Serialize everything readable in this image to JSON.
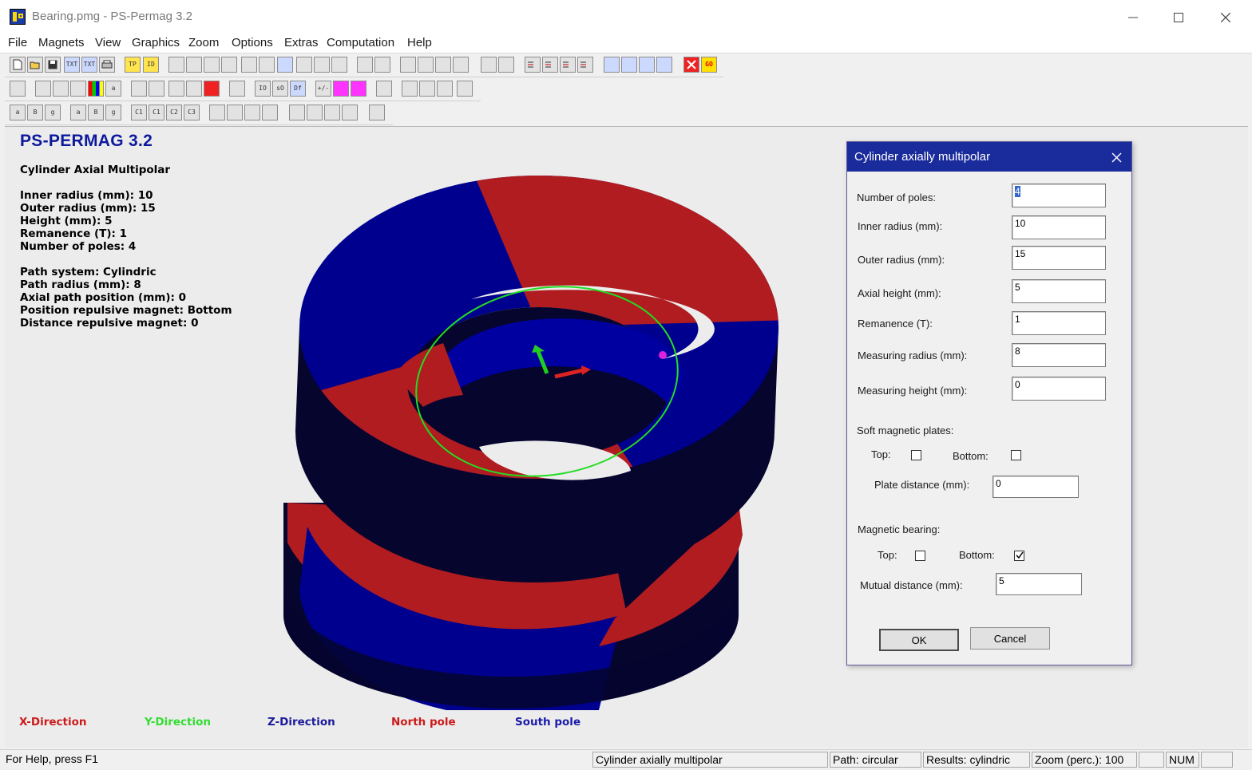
{
  "window": {
    "title": "Bearing.pmg - PS-Permag 3.2"
  },
  "menu": [
    "File",
    "Magnets",
    "View",
    "Graphics",
    "Zoom",
    "Options",
    "Extras",
    "Computation",
    "Help"
  ],
  "toolbar": {
    "row1": [
      "",
      "",
      "",
      "TXT",
      "TXT",
      "",
      "TP",
      "ID",
      "",
      "",
      "",
      "",
      "",
      "",
      "",
      "",
      "",
      "",
      "",
      "",
      "",
      "",
      "",
      "",
      "",
      "",
      "",
      "",
      "",
      "",
      "",
      "",
      "",
      "",
      "",
      "",
      "",
      "GO"
    ],
    "row2": [
      "",
      "",
      "",
      "",
      "",
      "a",
      "",
      "",
      "",
      "",
      "",
      "",
      "IO",
      "sO",
      "Df",
      "+/-",
      "",
      "",
      "",
      "",
      "",
      "",
      ""
    ],
    "row3": [
      "a",
      "B",
      "g",
      "a",
      "B",
      "g",
      "C1",
      "C1",
      "C2",
      "C3",
      "",
      "",
      "",
      "",
      "",
      "",
      "",
      "",
      ""
    ]
  },
  "info": {
    "heading": "PS-PERMAG 3.2",
    "magnet_type": "Cylinder Axial Multipolar",
    "params": [
      "Inner radius (mm): 10",
      "Outer radius (mm): 15",
      "Height (mm): 5",
      "Remanence (T): 1",
      "Number of poles: 4"
    ],
    "path": [
      "Path system: Cylindric",
      "Path radius (mm): 8",
      "Axial path position (mm): 0",
      "Position repulsive magnet: Bottom",
      "Distance repulsive magnet: 0"
    ]
  },
  "legend": [
    {
      "label": "X-Direction",
      "color": "#cc1a1a"
    },
    {
      "label": "Y-Direction",
      "color": "#33dd33"
    },
    {
      "label": "Z-Direction",
      "color": "#1a1a99"
    },
    {
      "label": "North pole",
      "color": "#cc1a1a"
    },
    {
      "label": "South pole",
      "color": "#1a1aaa"
    }
  ],
  "status": {
    "help": "For Help, press F1",
    "mode": "Cylinder axially multipolar",
    "path": "Path: circular",
    "results": "Results: cylindric",
    "zoom": "Zoom (perc.): 100",
    "num": "NUM"
  },
  "dialog": {
    "title": "Cylinder axially multipolar",
    "fields": [
      {
        "label": "Number of poles:",
        "value": "4"
      },
      {
        "label": "Inner radius (mm):",
        "value": "10"
      },
      {
        "label": "Outer radius (mm):",
        "value": "15"
      },
      {
        "label": "Axial height (mm):",
        "value": "5"
      },
      {
        "label": "Remanence (T):",
        "value": "1"
      },
      {
        "label": "Measuring radius (mm):",
        "value": "8"
      },
      {
        "label": "Measuring height (mm):",
        "value": "0"
      }
    ],
    "soft_plates": {
      "heading": "Soft magnetic plates:",
      "top_label": "Top:",
      "top_checked": false,
      "bottom_label": "Bottom:",
      "bottom_checked": false,
      "distance_label": "Plate distance (mm):",
      "distance_value": "0"
    },
    "bearing": {
      "heading": "Magnetic bearing:",
      "top_label": "Top:",
      "top_checked": false,
      "bottom_label": "Bottom:",
      "bottom_checked": true,
      "distance_label": "Mutual distance (mm):",
      "distance_value": "5"
    },
    "ok_label": "OK",
    "cancel_label": "Cancel"
  },
  "colors": {
    "north": "#b01c20",
    "south": "#00008f",
    "side": "#05052e",
    "path": "#22dd22",
    "accent": "#1a2b9c"
  }
}
